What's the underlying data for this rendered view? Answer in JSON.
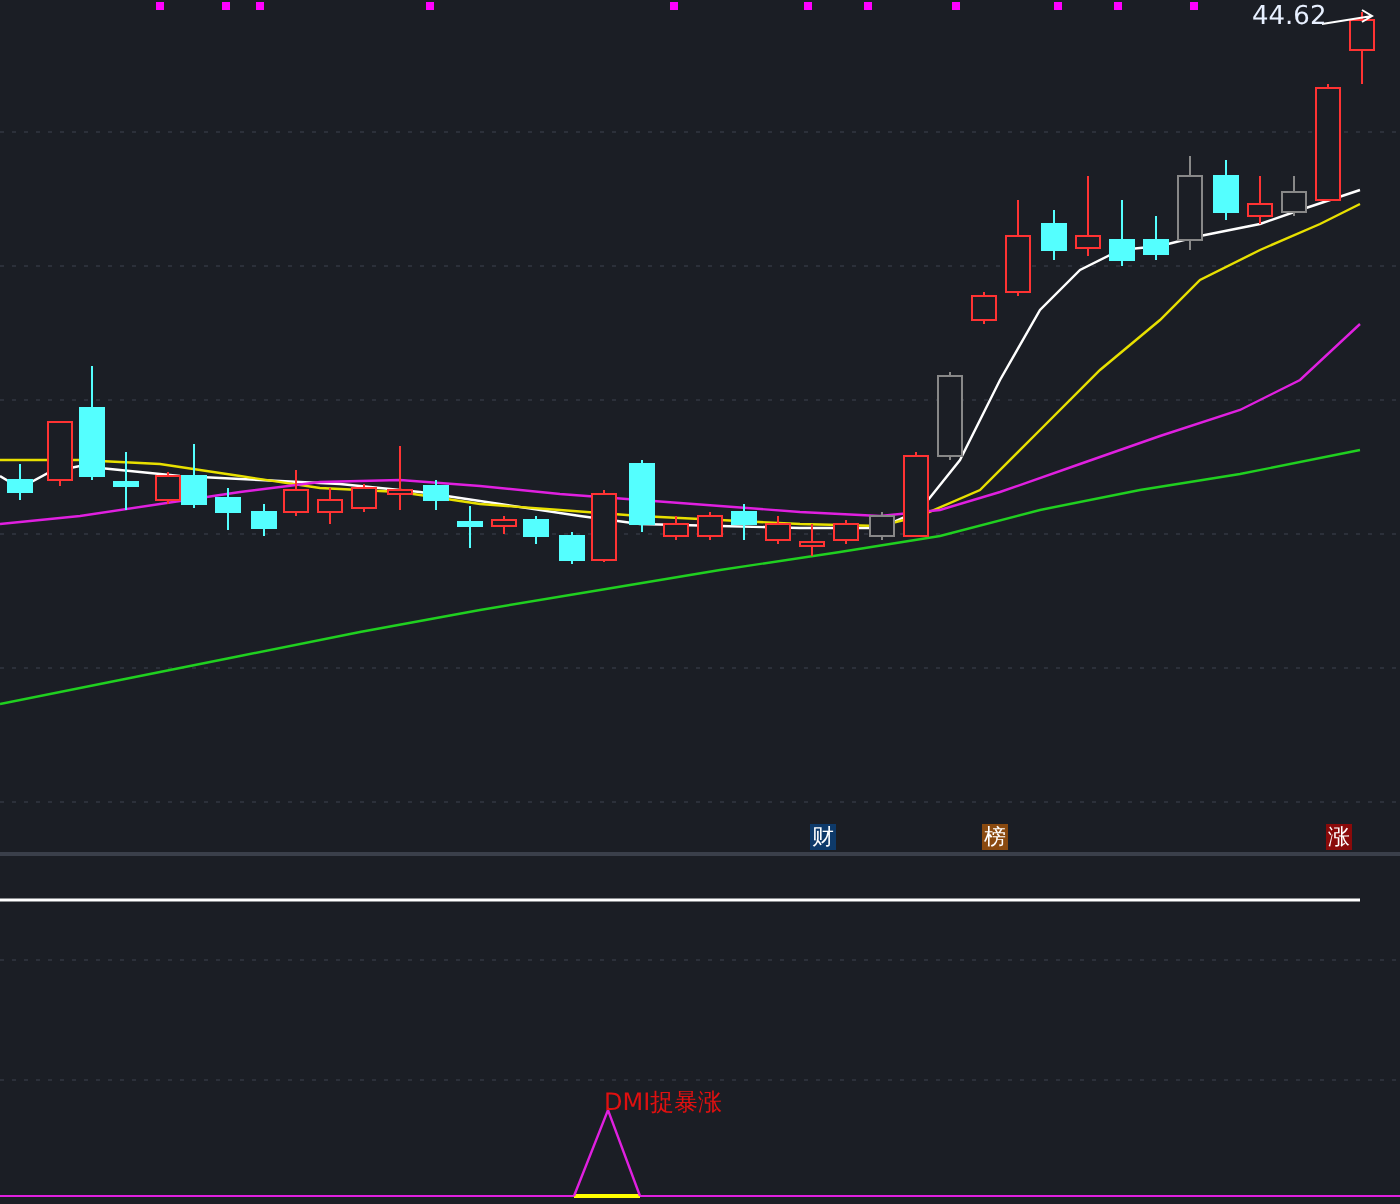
{
  "price_label": "44.62",
  "event_markers": [
    {
      "label": "财",
      "color": "#0e3a6a"
    },
    {
      "label": "榜",
      "color": "#8a4a10"
    },
    {
      "label": "涨",
      "color": "#8a0a0a"
    }
  ],
  "indicator": {
    "signal_label": "DMI捉暴涨"
  }
}
